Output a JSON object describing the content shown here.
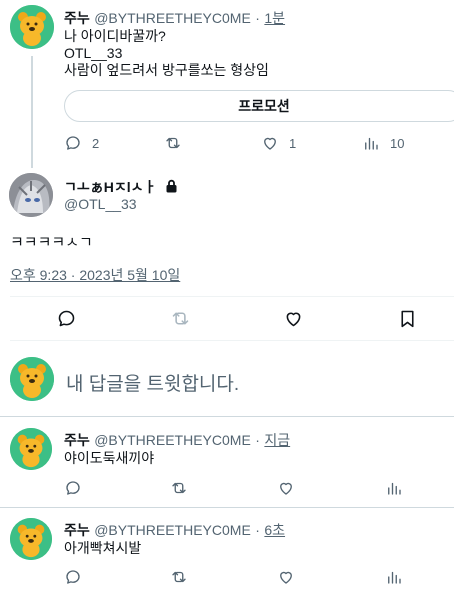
{
  "tweet1": {
    "name": "주누",
    "handle": "@BYTHREETHEYC0ME",
    "sep": "·",
    "time": "1분",
    "lines": [
      "나 아이디바꿀까?",
      "OTL__33",
      "사람이 엎드려서 방구를쏘는 형상임"
    ],
    "promo_label": "프로모션",
    "reply_count": "2",
    "like_count": "1",
    "view_count": "10"
  },
  "detail": {
    "name": "ㄱㅗぁHㅈlㅅㅏ",
    "handle": "@OTL__33",
    "text": "ㅋㅋㅋㅋㅅㄱ",
    "timestamp": "오후 9:23 · 2023년 5월 10일"
  },
  "reply_box": {
    "placeholder": "내 답글을 트윗합니다."
  },
  "reply1": {
    "name": "주누",
    "handle": "@BYTHREETHEYC0ME",
    "sep": "·",
    "time": "지금",
    "text": "야이도둑새끼야"
  },
  "reply2": {
    "name": "주누",
    "handle": "@BYTHREETHEYC0ME",
    "sep": "·",
    "time": "6초",
    "text": "아개빡쳐시발"
  },
  "colors": {
    "avatar_green": "#3cbf86",
    "text_primary": "#0f1419",
    "text_secondary": "#536471",
    "border": "#cfd9de"
  },
  "icons": [
    "reply-icon",
    "retweet-icon",
    "like-icon",
    "views-icon",
    "bookmark-icon",
    "lock-icon"
  ]
}
